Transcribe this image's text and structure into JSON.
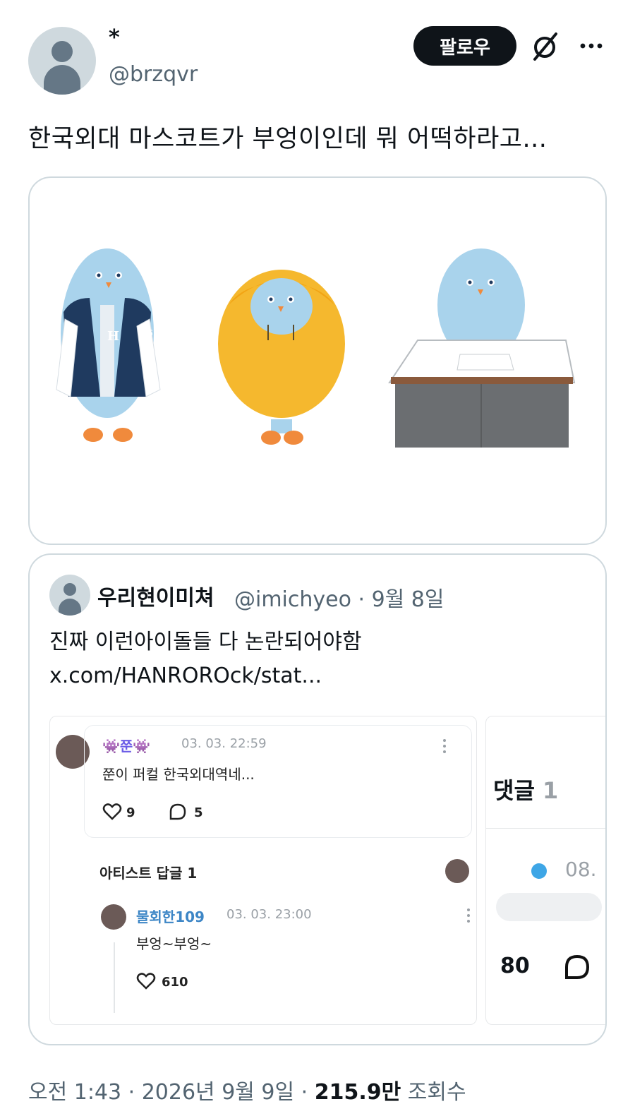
{
  "author": {
    "display_name": "*",
    "handle": "@brzqvr"
  },
  "actions": {
    "follow_label": "팔로우"
  },
  "tweet": {
    "text": "한국외대 마스코트가 부엉이인데 뭐 어떡하라고..."
  },
  "quote": {
    "name": "우리현이미쳐",
    "meta": "@imichyeo · 9월 8일",
    "line1": "진짜 이런아이돌들 다 논란되어야함",
    "line2": "x.com/HANROROck/stat..."
  },
  "screenshot": {
    "comment": {
      "user": "👾쭌👾",
      "time": "03. 03. 22:59",
      "text": "쭌이 퍼컬 한국외대역네...",
      "likes": "9",
      "replies": "5"
    },
    "artist_reply_label": "아티스트 답글 1",
    "reply": {
      "user": "물회한109",
      "time": "03. 03. 23:00",
      "text": "부엉~부엉~",
      "likes": "610"
    },
    "side": {
      "title": "댓글",
      "count": "1",
      "time": "08.",
      "likes": "80"
    }
  },
  "footer": {
    "time": "오전 1:43 · 2026년 9월 9일 · ",
    "views": "215.9만",
    "views_label": " 조회수"
  },
  "colors": {
    "follow_bg": "#0f1419",
    "muted": "#536471",
    "border": "#cfd9de",
    "mascot": "#a9d3ec",
    "hoodie": "#f5b82e",
    "jacket": "#1f3a5f"
  }
}
